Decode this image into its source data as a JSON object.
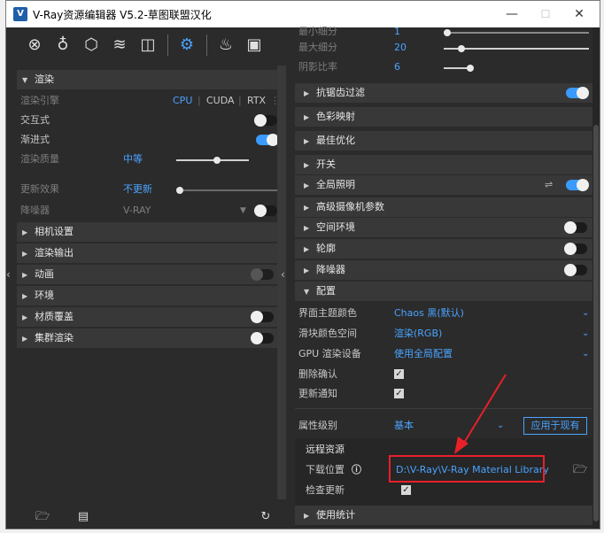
{
  "window": {
    "title": "V-Ray资源编辑器 V5.2-草图联盟汉化",
    "logo_letter": "V",
    "min_label": "—",
    "max_label": "☐",
    "close_label": "✕"
  },
  "toolbar": {
    "icons": [
      "materials-icon",
      "lights-icon",
      "geometry-icon",
      "layers-icon",
      "textures-icon",
      "settings-icon",
      "teapot-icon",
      "frame-buffer-icon"
    ]
  },
  "left": {
    "render_section": "渲染",
    "rows": {
      "engine_label": "渲染引擎",
      "engine_cpu": "CPU",
      "engine_cuda": "CUDA",
      "engine_rtx": "RTX",
      "interactive_label": "交互式",
      "progressive_label": "渐进式",
      "quality_label": "渲染质量",
      "quality_value": "中等",
      "update_label": "更新效果",
      "update_value": "不更新",
      "denoiser_label": "降噪器",
      "denoiser_value": "V-RAY"
    },
    "sections": [
      "相机设置",
      "渲染输出",
      "动画",
      "环境",
      "材质覆盖",
      "集群渲染"
    ]
  },
  "right": {
    "top_rows": [
      {
        "label": "最小细分",
        "value": "1"
      },
      {
        "label": "最大细分",
        "value": "20"
      },
      {
        "label": "阴影比率",
        "value": "6"
      }
    ],
    "sections": [
      "抗锯齿过滤",
      "色彩映射",
      "最佳优化",
      "开关",
      "全局照明",
      "高级摄像机参数",
      "空间环境",
      "轮廓",
      "降噪器",
      "配置"
    ],
    "config": {
      "theme_label": "界面主题颜色",
      "theme_value": "Chaos 黑(默认)",
      "slider_color_label": "滑块颜色空间",
      "slider_color_value": "渲染(RGB)",
      "gpu_label": "GPU 渲染设备",
      "gpu_value": "使用全局配置",
      "delete_confirm_label": "删除确认",
      "update_notify_label": "更新通知",
      "attr_level_label": "属性级别",
      "attr_level_value": "基本",
      "apply_button": "应用于现有",
      "remote_label": "远程资源",
      "download_label": "下载位置",
      "download_path": "D:\\V-Ray\\V-Ray Material Library",
      "check_update_label": "检查更新",
      "stats_section": "使用统计"
    }
  },
  "colors": {
    "accent": "#4aa3ff",
    "panel": "#2b2b2b",
    "section": "#383838",
    "highlight": "#e8202a"
  }
}
